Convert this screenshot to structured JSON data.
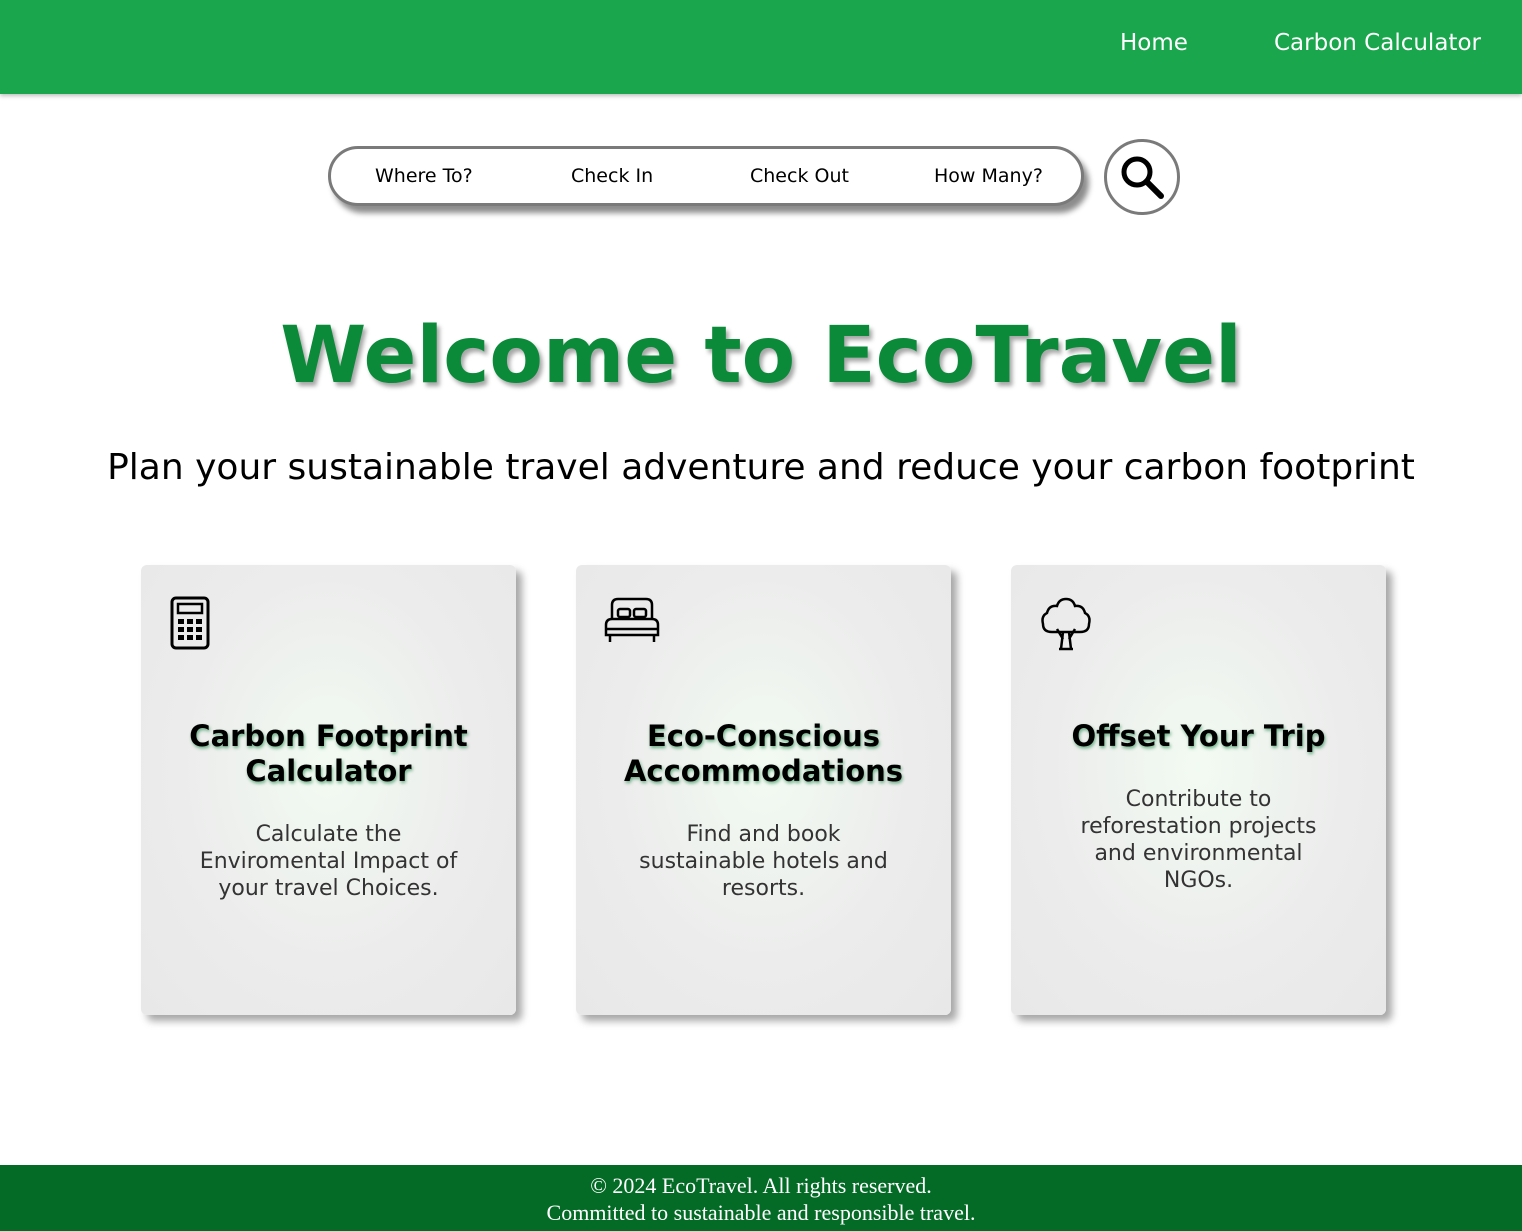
{
  "header": {
    "nav": {
      "home": "Home",
      "carbon_calculator": "Carbon Calculator"
    },
    "color": "#19a64c"
  },
  "search": {
    "where": "Where To?",
    "check_in": "Check In",
    "check_out": "Check Out",
    "how_many": "How Many?",
    "button_icon": "search-icon"
  },
  "hero": {
    "title": "Welcome to EcoTravel",
    "subtitle": "Plan your sustainable travel adventure and reduce your carbon footprint",
    "title_color": "#0b8a3a"
  },
  "cards": [
    {
      "icon": "calculator-icon",
      "title": "Carbon Footprint Calculator",
      "description": "Calculate the Enviromental Impact of your travel Choices."
    },
    {
      "icon": "bed-icon",
      "title": "Eco-Conscious Accommodations",
      "description": "Find and book sustainable hotels and resorts."
    },
    {
      "icon": "tree-icon",
      "title": "Offset Your Trip",
      "description": "Contribute to reforestation projects and environmental NGOs."
    }
  ],
  "footer": {
    "copyright": "© 2024 EcoTravel. All rights reserved.",
    "tagline": "Committed to sustainable and responsible travel.",
    "color": "#046b27"
  }
}
